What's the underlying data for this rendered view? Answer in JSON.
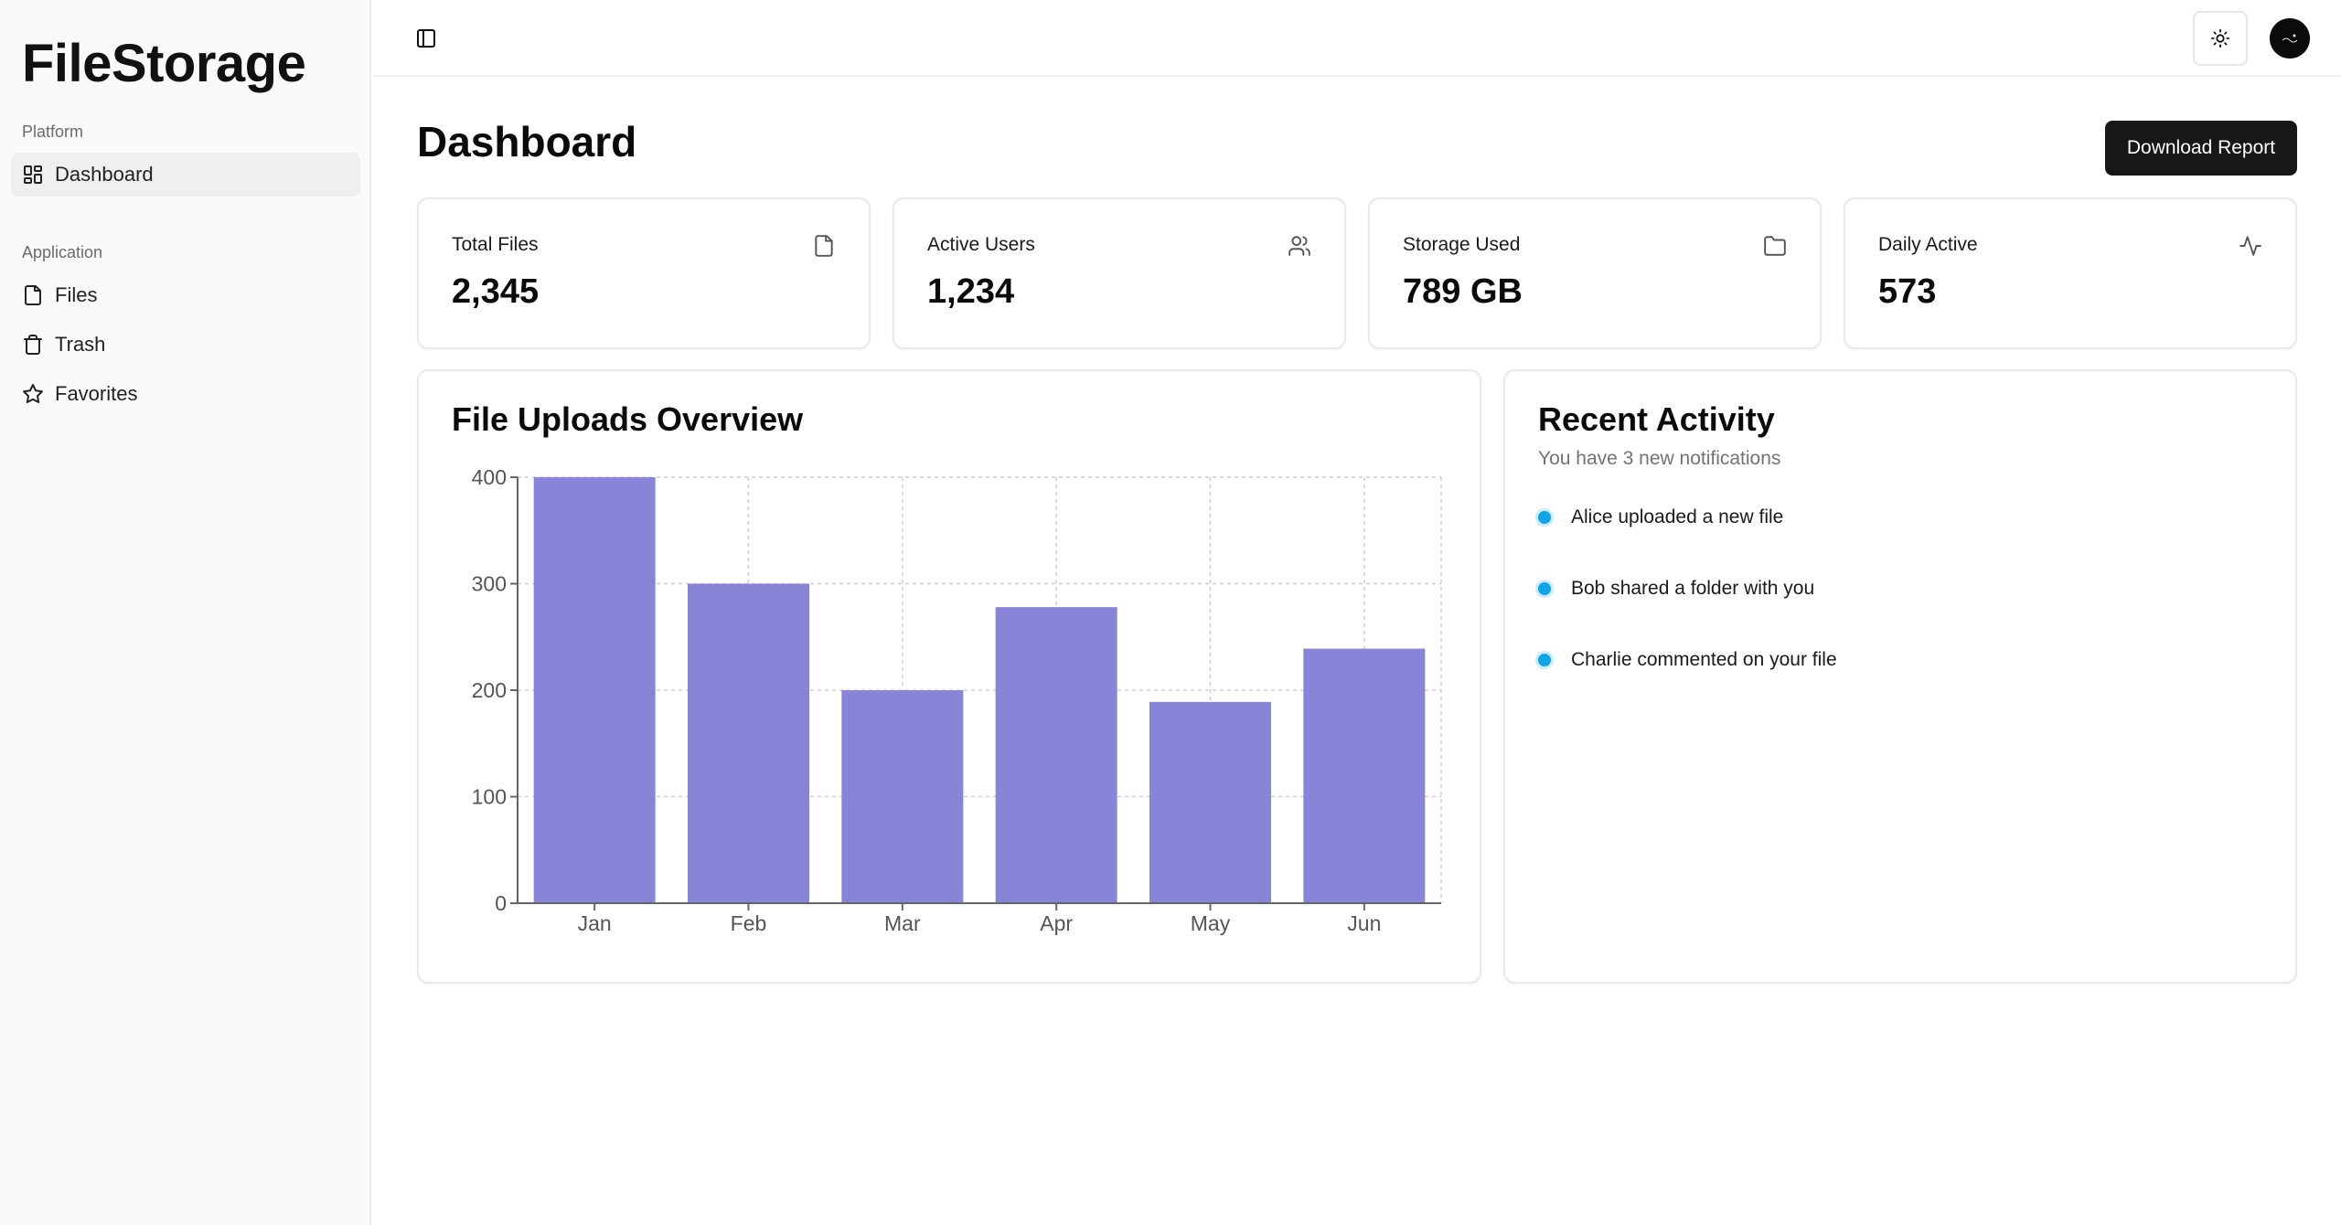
{
  "app": {
    "name": "FileStorage"
  },
  "sidebar": {
    "groups": [
      {
        "label": "Platform",
        "items": [
          {
            "label": "Dashboard",
            "icon": "dashboard-grid-icon",
            "active": true
          }
        ]
      },
      {
        "label": "Application",
        "items": [
          {
            "label": "Files",
            "icon": "file-icon",
            "active": false
          },
          {
            "label": "Trash",
            "icon": "trash-icon",
            "active": false
          },
          {
            "label": "Favorites",
            "icon": "star-icon",
            "active": false
          }
        ]
      }
    ]
  },
  "header": {
    "toggle_icon": "sidebar-toggle-icon",
    "theme_icon": "sun-icon"
  },
  "main": {
    "title": "Dashboard",
    "download_label": "Download Report",
    "stats": [
      {
        "label": "Total Files",
        "value": "2,345",
        "icon": "file-icon"
      },
      {
        "label": "Active Users",
        "value": "1,234",
        "icon": "users-icon"
      },
      {
        "label": "Storage Used",
        "value": "789 GB",
        "icon": "folder-icon"
      },
      {
        "label": "Daily Active",
        "value": "573",
        "icon": "activity-icon"
      }
    ],
    "uploads": {
      "title": "File Uploads Overview"
    },
    "activity": {
      "title": "Recent Activity",
      "subtitle": "You have 3 new notifications",
      "items": [
        "Alice uploaded a new file",
        "Bob shared a folder with you",
        "Charlie commented on your file"
      ]
    }
  },
  "colors": {
    "bar": "#8884d8",
    "accent_dot": "#0ea5e9",
    "button_bg": "#171717"
  },
  "chart_data": {
    "type": "bar",
    "categories": [
      "Jan",
      "Feb",
      "Mar",
      "Apr",
      "May",
      "Jun"
    ],
    "values": [
      400,
      300,
      200,
      278,
      189,
      239
    ],
    "title": "",
    "xlabel": "",
    "ylabel": "",
    "ylim": [
      0,
      400
    ],
    "yticks": [
      0,
      100,
      200,
      300,
      400
    ],
    "grid": true
  }
}
